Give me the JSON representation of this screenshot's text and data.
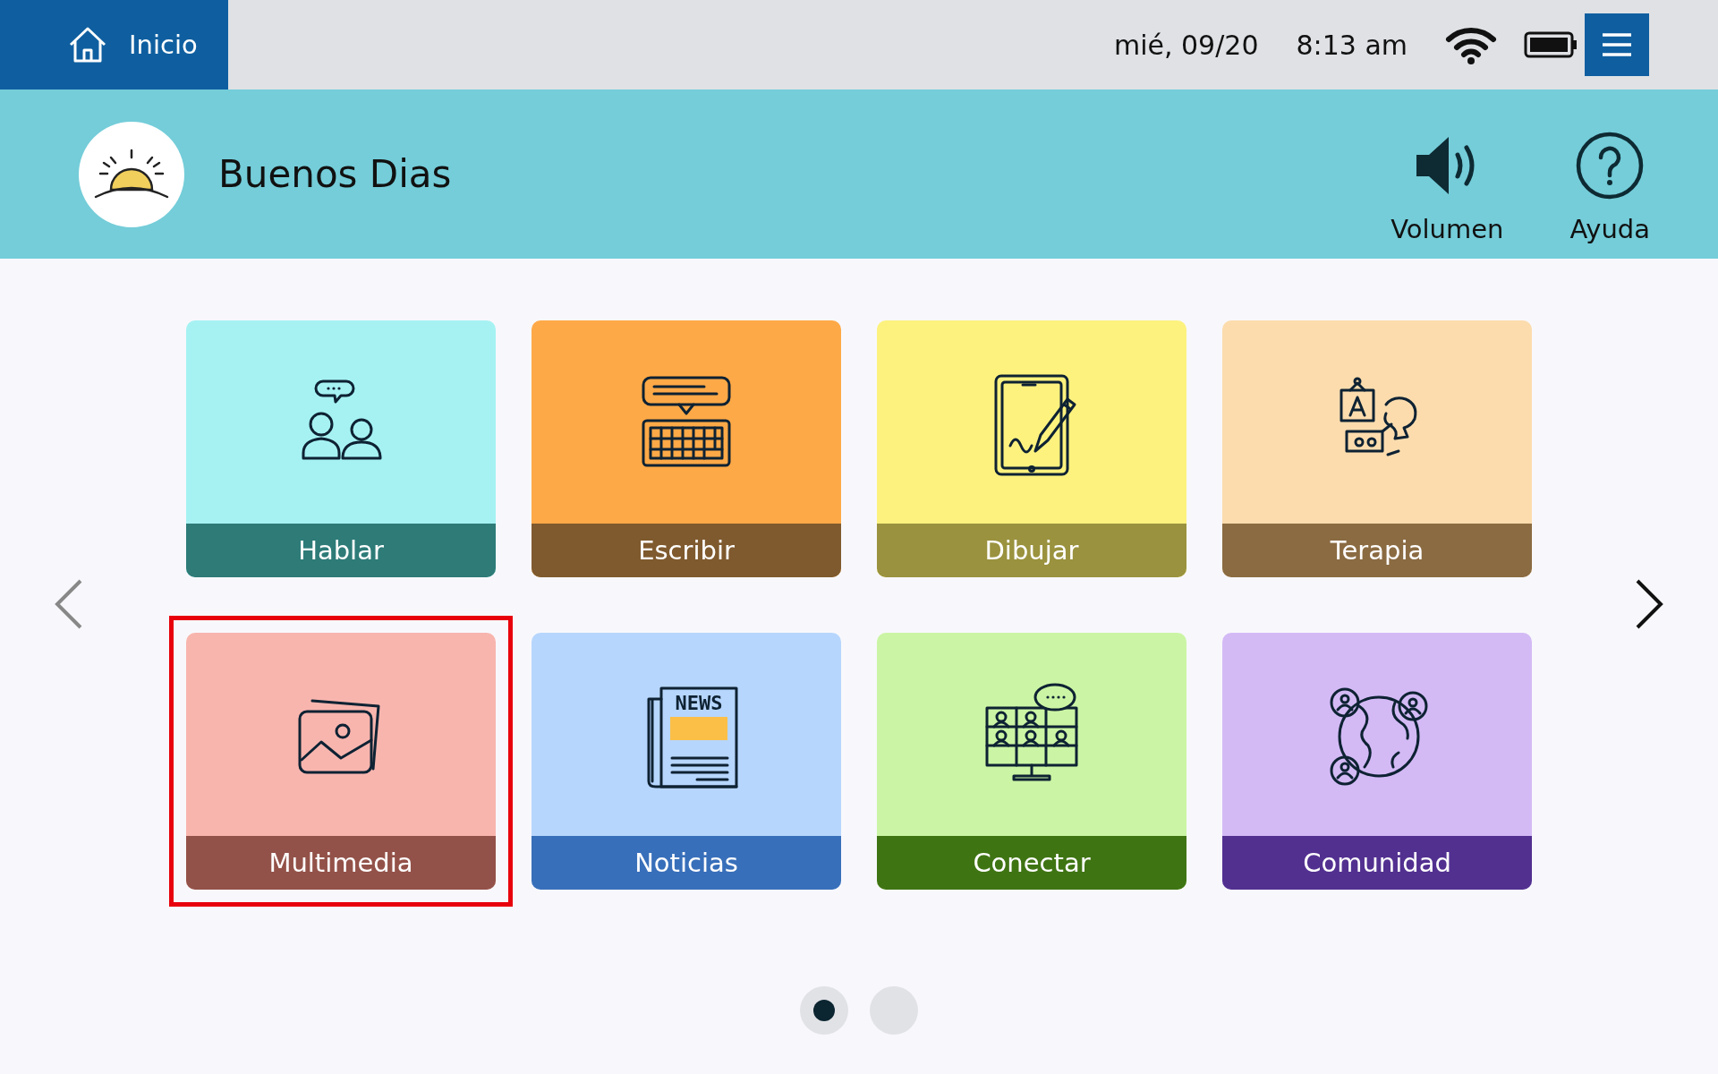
{
  "top_bar": {
    "home_label": "Inicio",
    "date": "mié, 09/20",
    "time": "8:13 am"
  },
  "header": {
    "greeting": "Buenos Dias",
    "actions": [
      {
        "label": "Volumen"
      },
      {
        "label": "Ayuda"
      }
    ]
  },
  "tiles": [
    {
      "label": "Hablar",
      "selected": false
    },
    {
      "label": "Escribir",
      "selected": false
    },
    {
      "label": "Dibujar",
      "selected": false
    },
    {
      "label": "Terapia",
      "selected": false
    },
    {
      "label": "Multimedia",
      "selected": true
    },
    {
      "label": "Noticias",
      "selected": false,
      "icon_text": "NEWS"
    },
    {
      "label": "Conectar",
      "selected": false
    },
    {
      "label": "Comunidad",
      "selected": false
    }
  ],
  "pages": [
    {
      "selected": true
    },
    {
      "selected": false
    }
  ]
}
